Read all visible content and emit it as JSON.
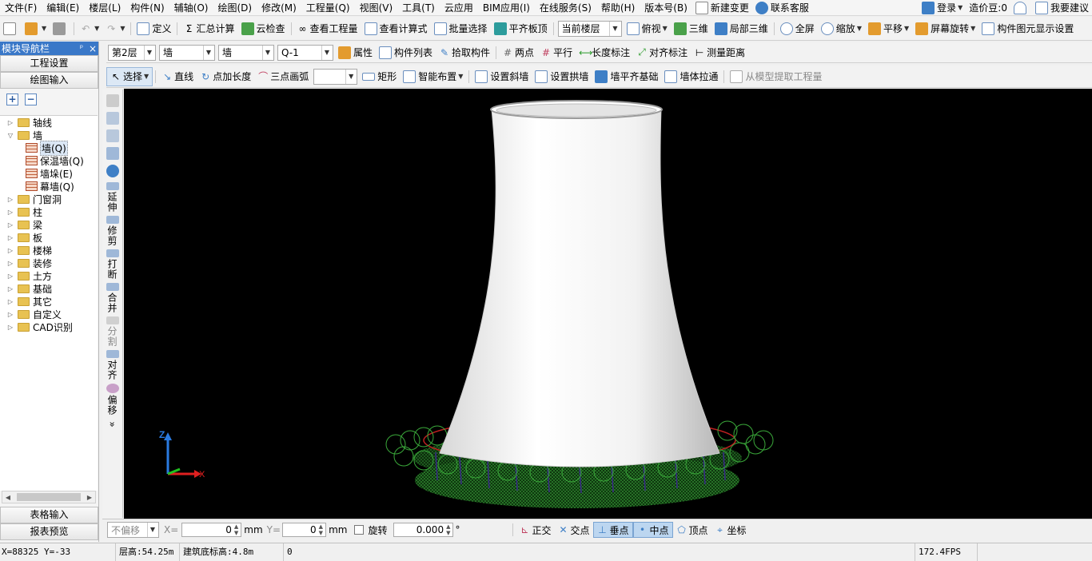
{
  "menubar": {
    "items": [
      "文件(F)",
      "编辑(E)",
      "楼层(L)",
      "构件(N)",
      "辅轴(O)",
      "绘图(D)",
      "修改(M)",
      "工程量(Q)",
      "视图(V)",
      "工具(T)",
      "云应用",
      "BIM应用(I)",
      "在线服务(S)",
      "帮助(H)",
      "版本号(B)"
    ],
    "new_change": "新建变更",
    "contact_service": "联系客服",
    "login": "登录",
    "zaojia_dou": "造价豆:0",
    "suggest": "我要建议"
  },
  "toolbar1": {
    "define": "定义",
    "sum_calc": "汇总计算",
    "cloud_check": "云检查",
    "view_quantity": "查看工程量",
    "view_formula": "查看计算式",
    "batch_select": "批量选择",
    "flush_slab": "平齐板顶",
    "current_floor": "当前楼层",
    "top_view": "俯视",
    "three_d": "三维",
    "local_3d": "局部三维",
    "full_screen": "全屏",
    "zoom": "缩放",
    "pan": "平移",
    "screen_rotate": "屏幕旋转",
    "display_settings": "构件图元显示设置"
  },
  "sidebar": {
    "title": "模块导航栏",
    "pin": "ᵖ",
    "close": "×",
    "tab_project": "工程设置",
    "tab_drawing": "绘图输入",
    "tree": [
      {
        "label": "轴线",
        "level": 0,
        "expanded": false,
        "type": "folder"
      },
      {
        "label": "墙",
        "level": 0,
        "expanded": true,
        "type": "folder"
      },
      {
        "label": "墙(Q)",
        "level": 1,
        "type": "wall",
        "selected": true
      },
      {
        "label": "保温墙(Q)",
        "level": 1,
        "type": "wall"
      },
      {
        "label": "墙垛(E)",
        "level": 1,
        "type": "wall"
      },
      {
        "label": "幕墙(Q)",
        "level": 1,
        "type": "wall"
      },
      {
        "label": "门窗洞",
        "level": 0,
        "expanded": false,
        "type": "folder"
      },
      {
        "label": "柱",
        "level": 0,
        "expanded": false,
        "type": "folder"
      },
      {
        "label": "梁",
        "level": 0,
        "expanded": false,
        "type": "folder"
      },
      {
        "label": "板",
        "level": 0,
        "expanded": false,
        "type": "folder"
      },
      {
        "label": "楼梯",
        "level": 0,
        "expanded": false,
        "type": "folder"
      },
      {
        "label": "装修",
        "level": 0,
        "expanded": false,
        "type": "folder"
      },
      {
        "label": "土方",
        "level": 0,
        "expanded": false,
        "type": "folder"
      },
      {
        "label": "基础",
        "level": 0,
        "expanded": false,
        "type": "folder"
      },
      {
        "label": "其它",
        "level": 0,
        "expanded": false,
        "type": "folder"
      },
      {
        "label": "自定义",
        "level": 0,
        "expanded": false,
        "type": "folder"
      },
      {
        "label": "CAD识别",
        "level": 0,
        "expanded": false,
        "type": "folder"
      }
    ],
    "tab_table": "表格输入",
    "tab_report": "报表预览"
  },
  "toolbar2": {
    "floor": "第2层",
    "category": "墙",
    "type": "墙",
    "component": "Q-1",
    "properties": "属性",
    "component_list": "构件列表",
    "pick_component": "拾取构件",
    "two_points": "两点",
    "parallel": "平行",
    "length_dim": "长度标注",
    "align_dim": "对齐标注",
    "measure_dist": "测量距离"
  },
  "toolbar3": {
    "select": "选择",
    "line": "直线",
    "point_length": "点加长度",
    "three_point_arc": "三点画弧",
    "rect": "矩形",
    "smart_layout": "智能布置",
    "set_slope_wall": "设置斜墙",
    "set_arch_wall": "设置拱墙",
    "wall_align_foundation": "墙平齐基础",
    "wall_pull": "墙体拉通",
    "extract_from_model": "从模型提取工程量"
  },
  "vtoolbar": {
    "extend": "延伸",
    "trim": "修剪",
    "break": "打断",
    "merge": "合并",
    "split": "分割",
    "align": "对齐",
    "offset": "偏移",
    "more": "»"
  },
  "viewport": {
    "axis_z": "Z",
    "axis_x": "X"
  },
  "bottombar": {
    "offset_mode": "不偏移",
    "x_label": "X=",
    "x_value": "0",
    "y_label": "Y=",
    "y_value": "0",
    "unit": "mm",
    "rotate": "旋转",
    "rotate_value": "0.000",
    "degree": "°",
    "snap_orthogonal": "正交",
    "snap_intersection": "交点",
    "snap_perpendicular": "垂点",
    "snap_midpoint": "中点",
    "snap_vertex": "顶点",
    "snap_coordinate": "坐标"
  },
  "statusbar": {
    "coords": "X=88325 Y=-33",
    "floor_height": "层高:54.25m",
    "base_elev": "建筑底标高:4.8m",
    "value": "0",
    "fps": "172.4FPS"
  }
}
